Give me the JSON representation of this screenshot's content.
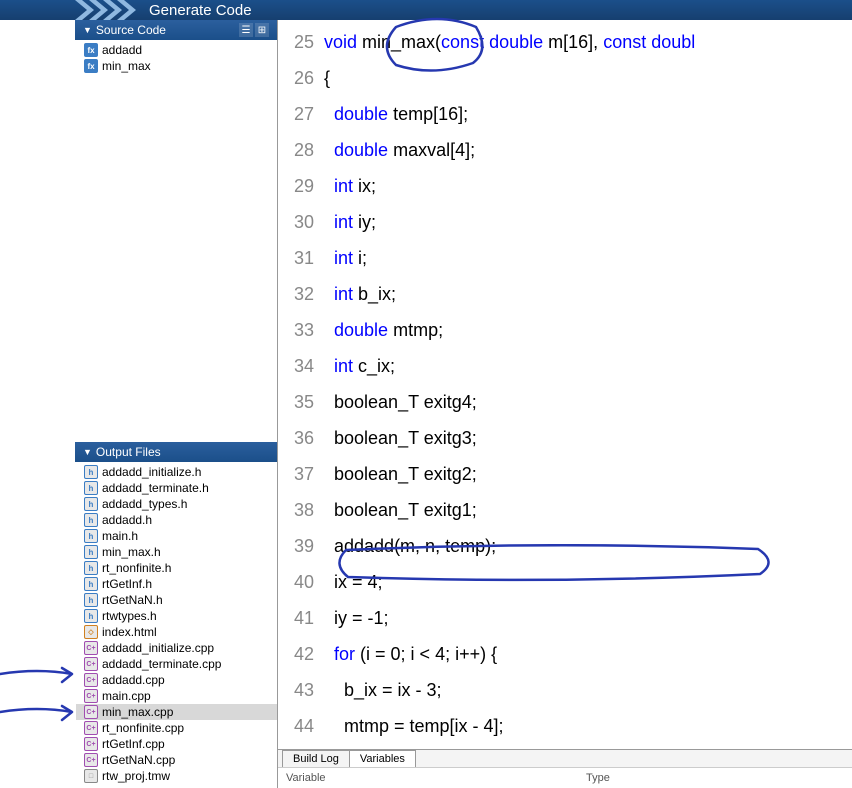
{
  "header": {
    "title": "Generate Code"
  },
  "sidebar": {
    "source_panel": {
      "title": "Source Code",
      "items": [
        {
          "icon": "f",
          "label": "addadd"
        },
        {
          "icon": "f",
          "label": "min_max"
        }
      ]
    },
    "output_panel": {
      "title": "Output Files",
      "items": [
        {
          "icon": "h",
          "label": "addadd_initialize.h",
          "selected": false
        },
        {
          "icon": "h",
          "label": "addadd_terminate.h",
          "selected": false
        },
        {
          "icon": "h",
          "label": "addadd_types.h",
          "selected": false
        },
        {
          "icon": "h",
          "label": "addadd.h",
          "selected": false
        },
        {
          "icon": "h",
          "label": "main.h",
          "selected": false
        },
        {
          "icon": "h",
          "label": "min_max.h",
          "selected": false
        },
        {
          "icon": "h",
          "label": "rt_nonfinite.h",
          "selected": false
        },
        {
          "icon": "h",
          "label": "rtGetInf.h",
          "selected": false
        },
        {
          "icon": "h",
          "label": "rtGetNaN.h",
          "selected": false
        },
        {
          "icon": "h",
          "label": "rtwtypes.h",
          "selected": false
        },
        {
          "icon": "html",
          "label": "index.html",
          "selected": false
        },
        {
          "icon": "cpp",
          "label": "addadd_initialize.cpp",
          "selected": false
        },
        {
          "icon": "cpp",
          "label": "addadd_terminate.cpp",
          "selected": false
        },
        {
          "icon": "cpp",
          "label": "addadd.cpp",
          "selected": false
        },
        {
          "icon": "cpp",
          "label": "main.cpp",
          "selected": false
        },
        {
          "icon": "cpp",
          "label": "min_max.cpp",
          "selected": true
        },
        {
          "icon": "cpp",
          "label": "rt_nonfinite.cpp",
          "selected": false
        },
        {
          "icon": "cpp",
          "label": "rtGetInf.cpp",
          "selected": false
        },
        {
          "icon": "cpp",
          "label": "rtGetNaN.cpp",
          "selected": false
        },
        {
          "icon": "tmw",
          "label": "rtw_proj.tmw",
          "selected": false
        }
      ]
    }
  },
  "code": {
    "lines": [
      {
        "n": 25,
        "tokens": [
          [
            "kw",
            "void"
          ],
          [
            "",
            " min_max("
          ],
          [
            "kw",
            "const"
          ],
          [
            "",
            " "
          ],
          [
            "kw",
            "double"
          ],
          [
            "",
            " m[16], "
          ],
          [
            "kw",
            "const"
          ],
          [
            "",
            " "
          ],
          [
            "kw",
            "doubl"
          ]
        ]
      },
      {
        "n": 26,
        "tokens": [
          [
            "",
            "{"
          ]
        ]
      },
      {
        "n": 27,
        "tokens": [
          [
            "",
            "  "
          ],
          [
            "kw",
            "double"
          ],
          [
            "",
            " temp[16];"
          ]
        ]
      },
      {
        "n": 28,
        "tokens": [
          [
            "",
            "  "
          ],
          [
            "kw",
            "double"
          ],
          [
            "",
            " maxval[4];"
          ]
        ]
      },
      {
        "n": 29,
        "tokens": [
          [
            "",
            "  "
          ],
          [
            "kw",
            "int"
          ],
          [
            "",
            " ix;"
          ]
        ]
      },
      {
        "n": 30,
        "tokens": [
          [
            "",
            "  "
          ],
          [
            "kw",
            "int"
          ],
          [
            "",
            " iy;"
          ]
        ]
      },
      {
        "n": 31,
        "tokens": [
          [
            "",
            "  "
          ],
          [
            "kw",
            "int"
          ],
          [
            "",
            " i;"
          ]
        ]
      },
      {
        "n": 32,
        "tokens": [
          [
            "",
            "  "
          ],
          [
            "kw",
            "int"
          ],
          [
            "",
            " b_ix;"
          ]
        ]
      },
      {
        "n": 33,
        "tokens": [
          [
            "",
            "  "
          ],
          [
            "kw",
            "double"
          ],
          [
            "",
            " mtmp;"
          ]
        ]
      },
      {
        "n": 34,
        "tokens": [
          [
            "",
            "  "
          ],
          [
            "kw",
            "int"
          ],
          [
            "",
            " c_ix;"
          ]
        ]
      },
      {
        "n": 35,
        "tokens": [
          [
            "",
            "  boolean_T exitg4;"
          ]
        ]
      },
      {
        "n": 36,
        "tokens": [
          [
            "",
            "  boolean_T exitg3;"
          ]
        ]
      },
      {
        "n": 37,
        "tokens": [
          [
            "",
            "  boolean_T exitg2;"
          ]
        ]
      },
      {
        "n": 38,
        "tokens": [
          [
            "",
            "  boolean_T exitg1;"
          ]
        ]
      },
      {
        "n": 39,
        "tokens": [
          [
            "",
            "  addadd(m, n, temp);"
          ]
        ]
      },
      {
        "n": 40,
        "tokens": [
          [
            "",
            "  ix = 4;"
          ]
        ]
      },
      {
        "n": 41,
        "tokens": [
          [
            "",
            "  iy = -1;"
          ]
        ]
      },
      {
        "n": 42,
        "tokens": [
          [
            "",
            "  "
          ],
          [
            "kw",
            "for"
          ],
          [
            "",
            " (i = 0; i < 4; i++) {"
          ]
        ]
      },
      {
        "n": 43,
        "tokens": [
          [
            "",
            "    b_ix = ix - 3;"
          ]
        ]
      },
      {
        "n": 44,
        "tokens": [
          [
            "",
            "    mtmp = temp[ix - 4];"
          ]
        ]
      }
    ]
  },
  "bottom": {
    "tabs": [
      {
        "label": "Build Log",
        "active": false
      },
      {
        "label": "Variables",
        "active": true
      }
    ],
    "headers": {
      "col1": "Variable",
      "col2": "Type"
    }
  }
}
